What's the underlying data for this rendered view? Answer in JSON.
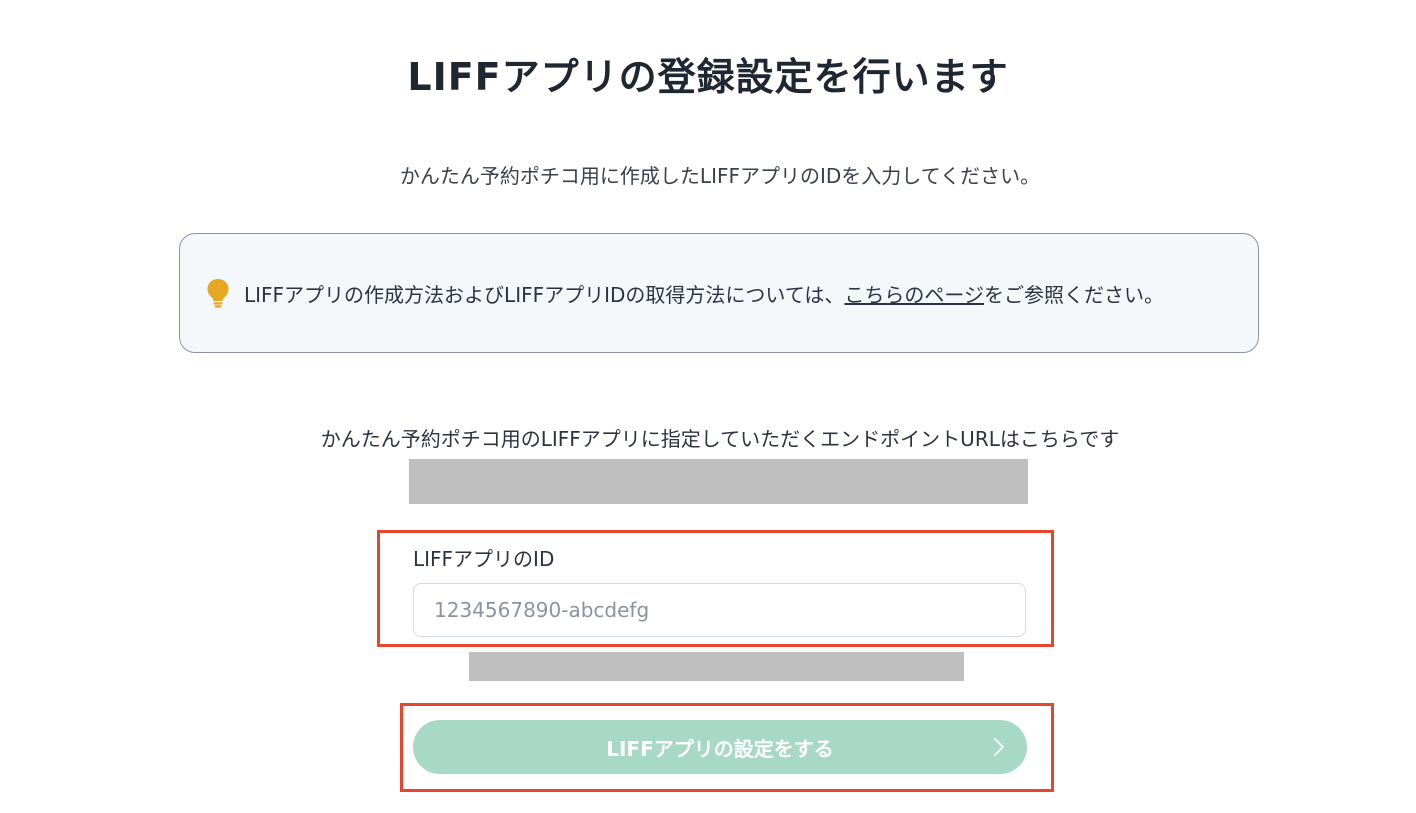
{
  "page": {
    "title": "LIFFアプリの登録設定を行います",
    "intro": "かんたん予約ポチコ用に作成したLIFFアプリのIDを入力してください。"
  },
  "info": {
    "icon": "lightbulb-icon",
    "icon_color": "#e5a823",
    "text_before": "LIFFアプリの作成方法およびLIFFアプリIDの取得方法については、",
    "link_text": "こちらのページ",
    "text_after": "をご参照ください。"
  },
  "endpoint": {
    "label": "かんたん予約ポチコ用のLIFFアプリに指定していただくエンドポイントURLはこちらです"
  },
  "form": {
    "id_label": "LIFFアプリのID",
    "id_value": "",
    "id_placeholder": "1234567890-abcdefg"
  },
  "submit": {
    "label": "LIFFアプリの設定をする",
    "icon": "chevron-right-icon",
    "color": "#a8d8c6"
  },
  "highlight_color": "#e8452f"
}
